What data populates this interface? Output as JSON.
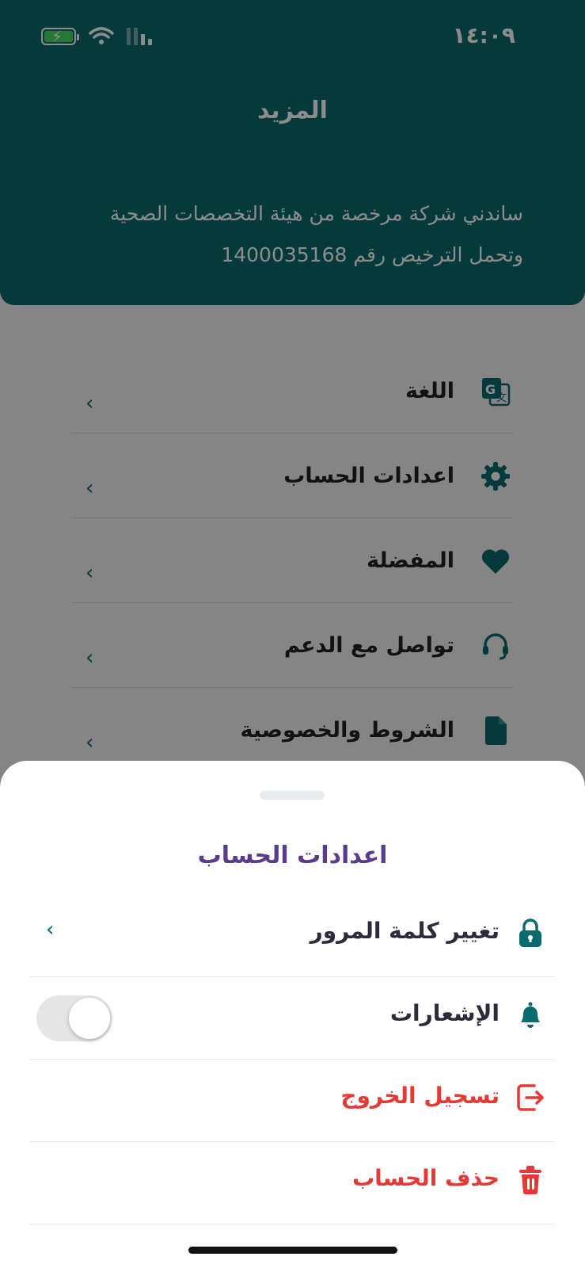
{
  "status": {
    "time": "١٤:٠٩"
  },
  "header": {
    "title": "المزيد",
    "license_line1": "ساندني شركة مرخصة من هيئة التخصصات الصحية",
    "license_line2": "وتحمل الترخيص رقم 1400035168"
  },
  "menu": [
    {
      "label": "اللغة",
      "icon": "translate-icon"
    },
    {
      "label": "اعدادات الحساب",
      "icon": "gear-icon"
    },
    {
      "label": "المفضلة",
      "icon": "heart-icon"
    },
    {
      "label": "تواصل مع الدعم",
      "icon": "headset-icon"
    },
    {
      "label": "الشروط والخصوصية",
      "icon": "document-icon"
    }
  ],
  "sheet": {
    "title": "اعدادات الحساب",
    "change_password": "تغيير كلمة المرور",
    "notifications": "الإشعارات",
    "notifications_enabled": false,
    "logout": "تسجيل الخروج",
    "delete_account": "حذف الحساب"
  },
  "colors": {
    "primary": "#0a6b6e",
    "title_purple": "#5a3b8c",
    "danger": "#e53935"
  }
}
